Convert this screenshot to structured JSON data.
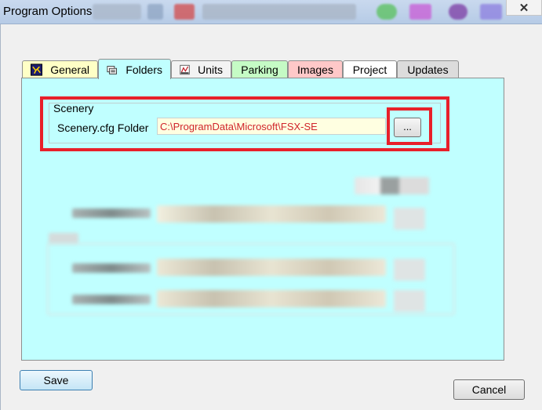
{
  "window": {
    "title": "Program Options",
    "close_glyph": "✕"
  },
  "tabs": [
    {
      "label": "General",
      "icon": "general-icon",
      "color": "#ffffc6"
    },
    {
      "label": "Folders",
      "icon": "folders-icon",
      "color": "#c0ffff",
      "active": true
    },
    {
      "label": "Units",
      "icon": "units-icon",
      "color": "#f3f3f3"
    },
    {
      "label": "Parking",
      "color": "#c5fbc5"
    },
    {
      "label": "Images",
      "color": "#ffc8c8"
    },
    {
      "label": "Project",
      "color": "#ffffff"
    },
    {
      "label": "Updates",
      "color": "#dcdcdc"
    }
  ],
  "scenery": {
    "group_label": "Scenery",
    "field_label": "Scenery.cfg Folder",
    "folder_value": "C:\\ProgramData\\Microsoft\\FSX-SE",
    "browse_label": "..."
  },
  "buttons": {
    "save": "Save",
    "cancel": "Cancel"
  },
  "colors": {
    "panel": "#c0ffff",
    "highlight": "#e8202a",
    "path_text": "#d0242b"
  }
}
